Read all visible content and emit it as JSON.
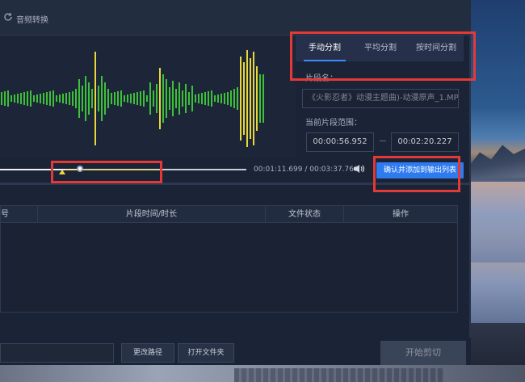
{
  "app": {
    "title": "音频转换",
    "title_icon": "refresh-icon"
  },
  "tabs": [
    {
      "label": "手动分割",
      "active": true
    },
    {
      "label": "平均分割",
      "active": false
    },
    {
      "label": "按时间分割",
      "active": false
    }
  ],
  "clip": {
    "name_label": "片段名：",
    "name_value": "《火影忍者》动漫主题曲)-动漫原声_1.MP3",
    "range_label": "当前片段范围：",
    "start_time": "00:00:56.952",
    "end_time": "00:02:20.227"
  },
  "playback": {
    "current_time": "00:01:11.699",
    "separator": "/",
    "total_time": "00:03:37.760",
    "progress": 0.329,
    "segment_start": 0.261,
    "segment_end": 0.642,
    "volume_icon": "speaker-icon",
    "confirm_label": "确认并添加到输出列表"
  },
  "table": {
    "columns": [
      "号",
      "片段时间/时长",
      "文件状态",
      "操作"
    ]
  },
  "footer": {
    "change_path_label": "更改路径",
    "open_folder_label": "打开文件夹",
    "start_label": "开始剪切"
  },
  "colors": {
    "accent": "#2e7bf0",
    "highlight": "#e53935",
    "wave_green": "#3ec03a",
    "wave_yellow": "#e8d83a"
  }
}
